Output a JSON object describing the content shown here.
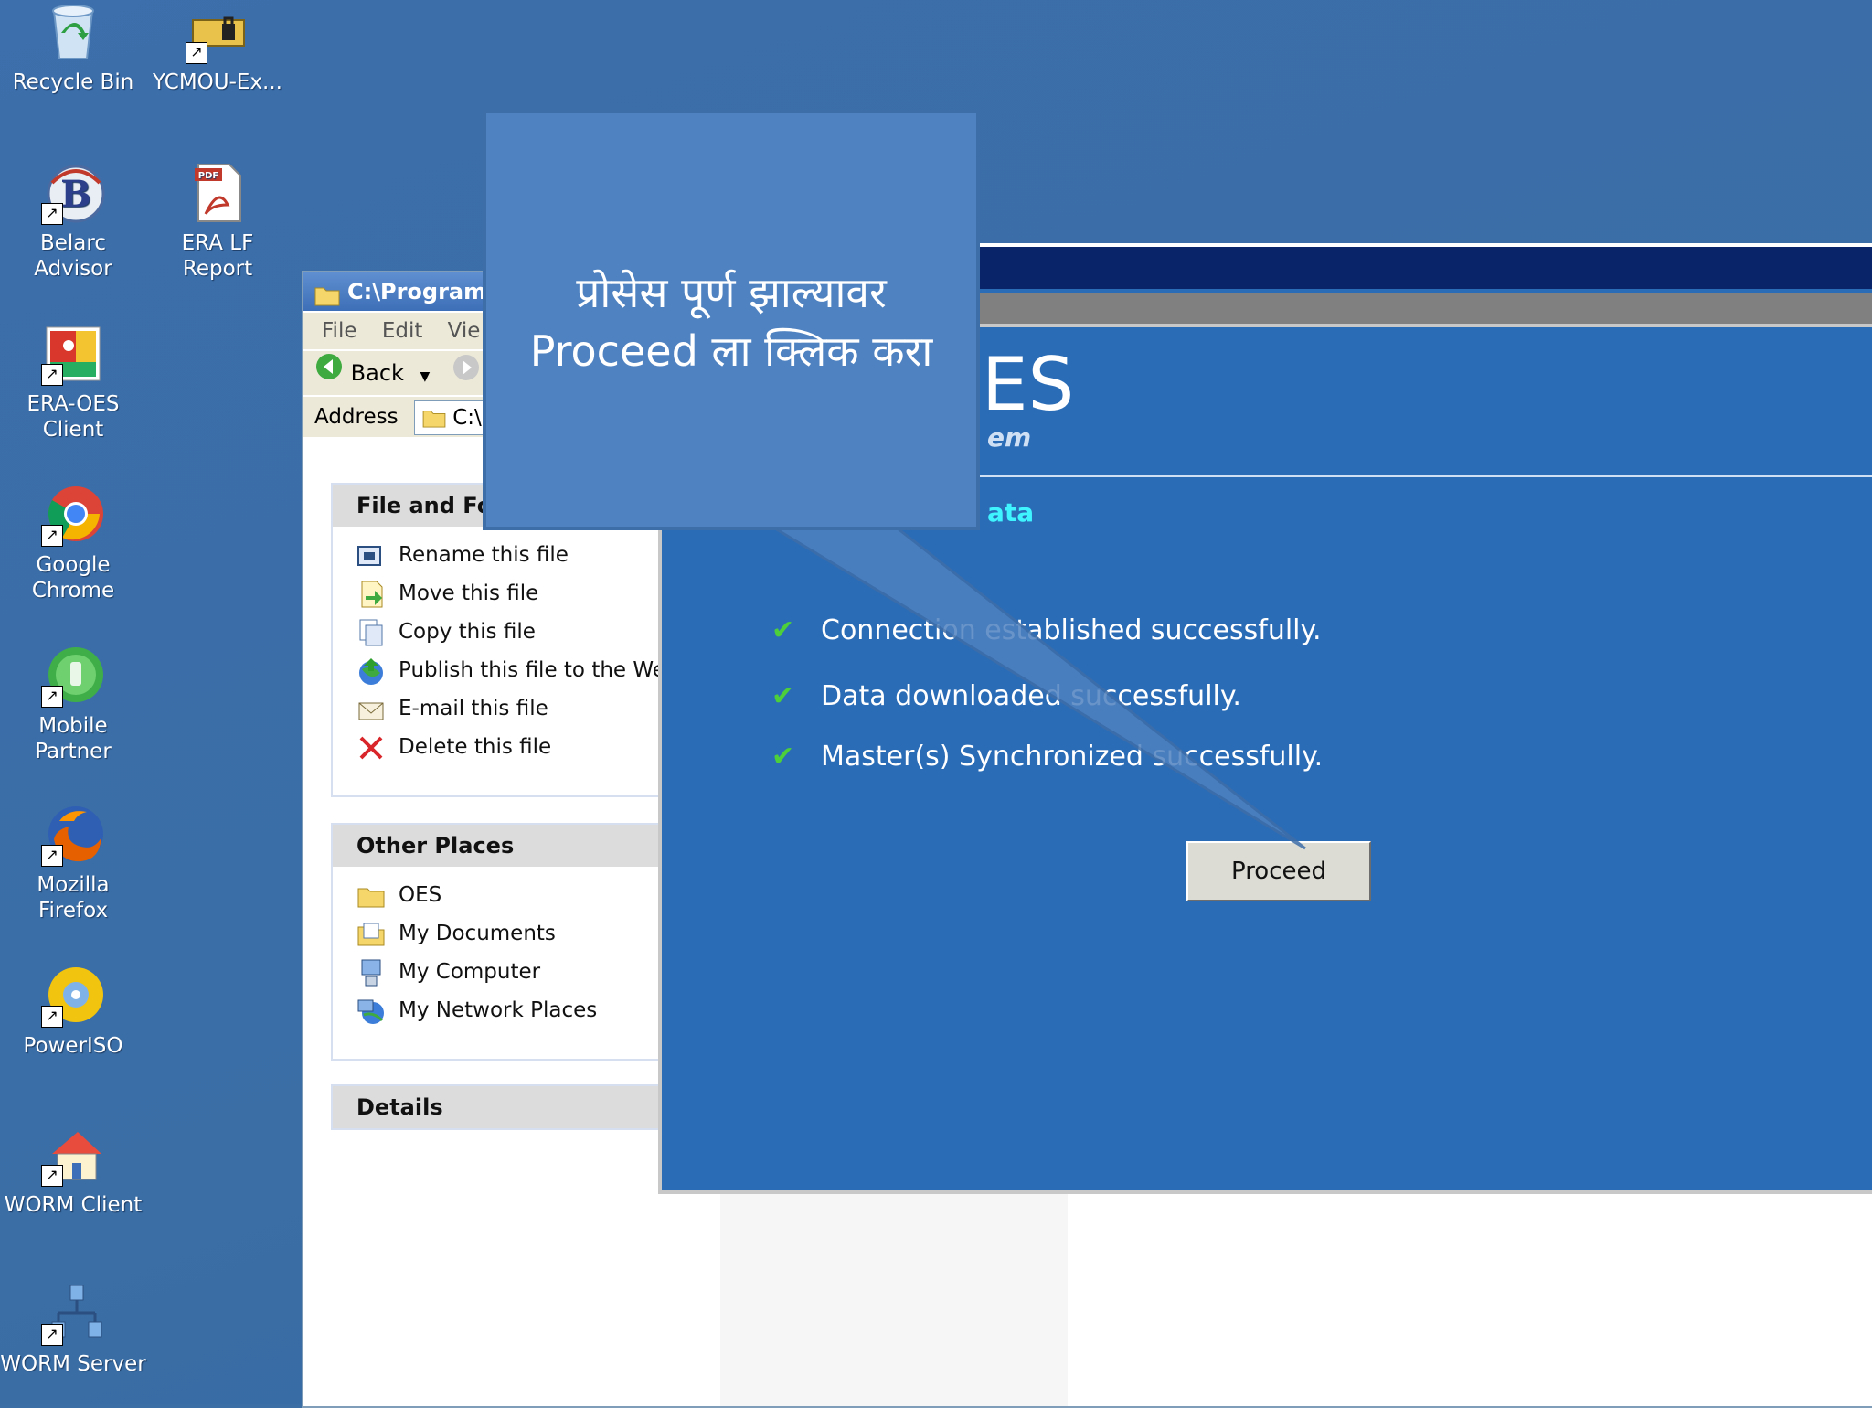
{
  "desktop": {
    "icons": [
      {
        "label": "Recycle Bin",
        "icon": "recycle-bin-icon"
      },
      {
        "label": "YCMOU-Ex...",
        "icon": "secure-drive-icon"
      },
      {
        "label": "Belarc Advisor",
        "icon": "belarc-icon"
      },
      {
        "label": "ERA LF Report",
        "icon": "pdf-icon"
      },
      {
        "label": "ERA-OES Client",
        "icon": "oes-client-icon"
      },
      {
        "label": "Google Chrome",
        "icon": "chrome-icon"
      },
      {
        "label": "Mobile Partner",
        "icon": "mobile-partner-icon"
      },
      {
        "label": "Mozilla Firefox",
        "icon": "firefox-icon"
      },
      {
        "label": "PowerISO",
        "icon": "poweriso-icon"
      },
      {
        "label": "WORM Client",
        "icon": "worm-client-icon"
      },
      {
        "label": "WORM Server",
        "icon": "worm-server-icon"
      }
    ],
    "colors": {
      "background": "#3a6ea5"
    }
  },
  "explorer": {
    "title": "C:\\Program",
    "menu": [
      "File",
      "Edit",
      "Vie"
    ],
    "toolbar": {
      "back_label": "Back"
    },
    "address": {
      "label": "Address",
      "value": "C:\\P"
    },
    "file_tasks": {
      "header": "File and Fol",
      "items": [
        {
          "label": "Rename this file",
          "icon": "rename-icon"
        },
        {
          "label": "Move this file",
          "icon": "move-icon"
        },
        {
          "label": "Copy this file",
          "icon": "copy-icon"
        },
        {
          "label": "Publish this file to the Web",
          "icon": "publish-web-icon"
        },
        {
          "label": "E-mail this file",
          "icon": "email-icon"
        },
        {
          "label": "Delete this file",
          "icon": "delete-icon"
        }
      ]
    },
    "other_places": {
      "header": "Other Places",
      "items": [
        {
          "label": "OES",
          "icon": "folder-icon"
        },
        {
          "label": "My Documents",
          "icon": "my-documents-icon"
        },
        {
          "label": "My Computer",
          "icon": "my-computer-icon"
        },
        {
          "label": "My Network Places",
          "icon": "network-places-icon"
        }
      ]
    },
    "details": {
      "header": "Details"
    }
  },
  "oes": {
    "logo_partial": "ES",
    "tagline_partial": "em",
    "subhead_partial": "ata",
    "statuses": [
      "Connection established successfully.",
      "Data downloaded successfully.",
      "Master(s) Synchronized successfully."
    ],
    "proceed_label": "Proceed",
    "colors": {
      "background": "#2b6cb6",
      "check": "#4ccf3b",
      "subhead": "#3ff4ff"
    }
  },
  "callout": {
    "line1": "प्रोसेस पूर्ण झाल्यावर",
    "line2": "Proceed ला क्लिक करा",
    "colors": {
      "fill": "#4f82c0"
    }
  }
}
